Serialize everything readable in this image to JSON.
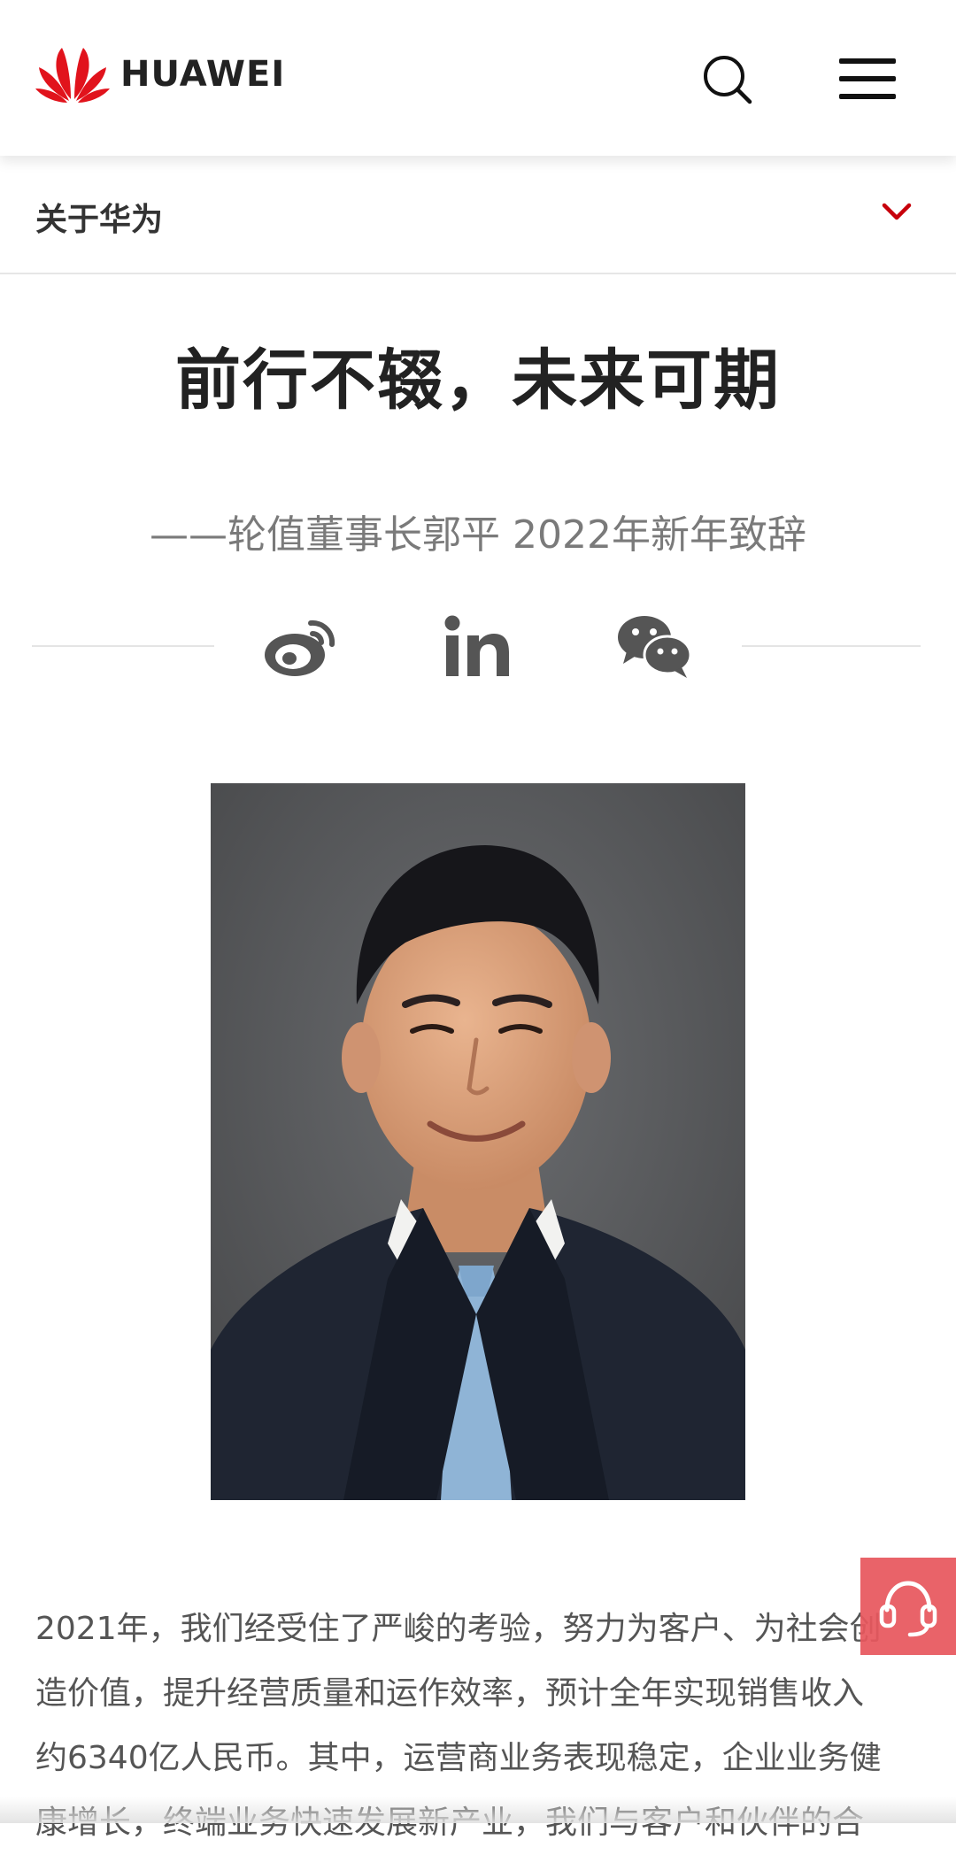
{
  "header": {
    "brand": "HUAWEI",
    "logo_icon": "huawei-flower-logo-icon",
    "search_icon": "search-icon",
    "menu_icon": "hamburger-menu-icon",
    "brand_color": "#e1131c"
  },
  "section_bar": {
    "title": "关于华为",
    "chevron_icon": "chevron-down-icon",
    "chevron_color": "#c7000b"
  },
  "article": {
    "headline": "前行不辍，未来可期",
    "subtitle": "——轮值董事长郭平 2022年新年致辞",
    "share": {
      "icons": [
        "weibo-icon",
        "linkedin-icon",
        "wechat-icon"
      ],
      "icon_color": "#555555"
    },
    "photo": {
      "subject": "portrait-photo"
    },
    "body_lines": [
      "2021年，我们经受住了严峻的考验，努力为客户、为社会创",
      "造价值，提升经营质量和运作效率，预计全年实现销售收入",
      "约6340亿人民币。其中，运营商业务表现稳定，企业业务健",
      "康增长，终端业务快速发展新产业，我们与客户和伙伴的合"
    ]
  },
  "floating": {
    "service_icon": "customer-service-headset-icon",
    "service_color": "#e8585e"
  }
}
